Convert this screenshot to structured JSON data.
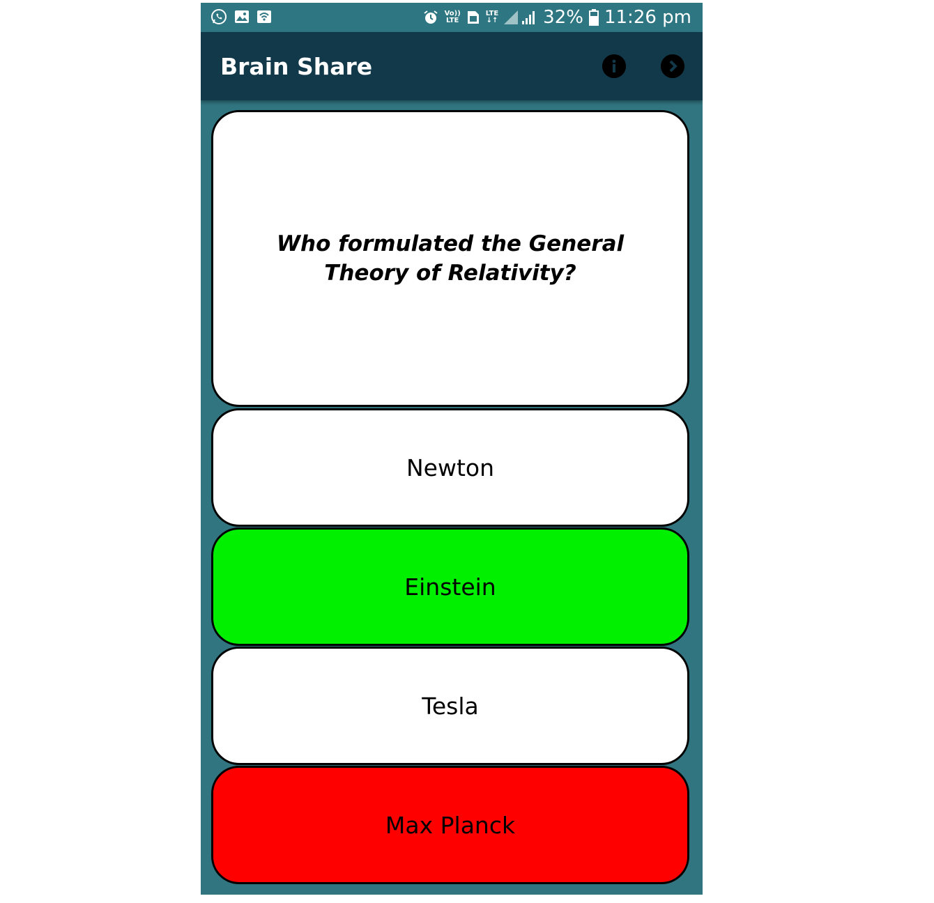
{
  "status_bar": {
    "left_icons": [
      "whatsapp-icon",
      "gallery-icon",
      "wifi-hotspot-icon"
    ],
    "right_icons": [
      "alarm-icon",
      "volte-icon",
      "sim-icon",
      "lte-icon",
      "signal-icon"
    ],
    "volte_label_top": "Vo))",
    "volte_label_bottom": "LTE",
    "lte_label": "LTE",
    "battery": "32%",
    "time": "11:26 pm"
  },
  "app_bar": {
    "title": "Brain Share",
    "info_icon": "info-icon",
    "next_icon": "chevron-right-icon"
  },
  "quiz": {
    "question": "Who formulated the General Theory of Relativity?",
    "options": [
      {
        "label": "Newton",
        "state": "neutral",
        "color": "#ffffff"
      },
      {
        "label": "Einstein",
        "state": "correct",
        "color": "#00f000"
      },
      {
        "label": "Tesla",
        "state": "neutral",
        "color": "#ffffff"
      },
      {
        "label": "Max Planck",
        "state": "wrong",
        "color": "#ff0000"
      }
    ]
  },
  "colors": {
    "background": "#317580",
    "app_bar": "#12394a",
    "status_bar": "#2e7682"
  }
}
